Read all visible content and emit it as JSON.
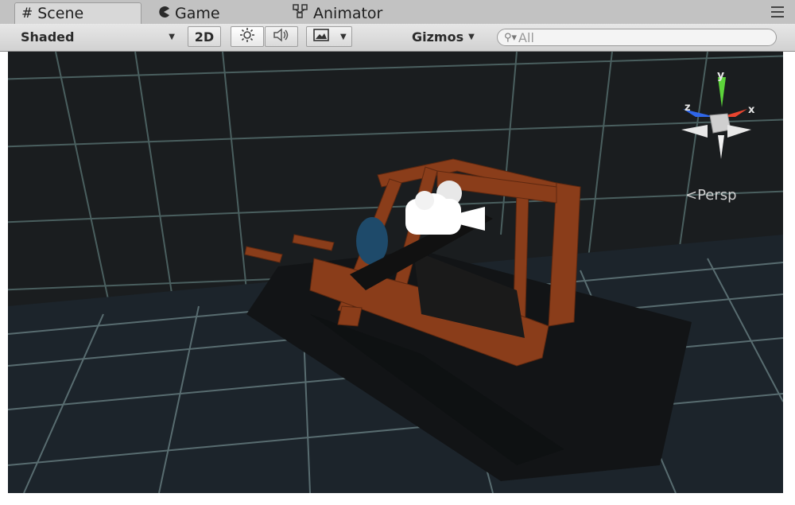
{
  "tabs": [
    {
      "label": "Scene",
      "icon": "grid-hash-icon",
      "active": true
    },
    {
      "label": "Game",
      "icon": "pacman-icon",
      "active": false
    },
    {
      "label": "Animator",
      "icon": "nodes-icon",
      "active": false
    }
  ],
  "toolbar": {
    "shading_mode": "Shaded",
    "mode_2d_label": "2D",
    "gizmos_label": "Gizmos",
    "search_placeholder": "All"
  },
  "viewport": {
    "projection_label": "Persp",
    "axis_labels": {
      "x": "x",
      "y": "y",
      "z": "z"
    },
    "colors": {
      "grid": "#6f8c8d",
      "frame": "#8a3d1a",
      "dark_plane": "#121416",
      "floor": "#1f2a33"
    }
  }
}
